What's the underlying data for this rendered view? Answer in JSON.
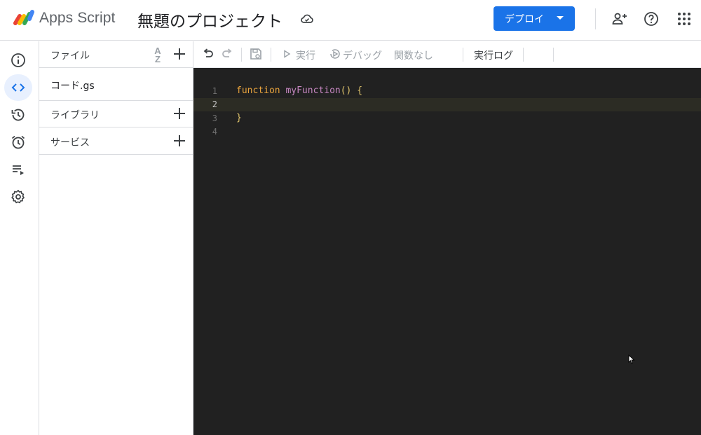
{
  "header": {
    "app_name": "Apps Script",
    "project_title": "無題のプロジェクト",
    "deploy_label": "デプロイ"
  },
  "panel": {
    "files_label": "ファイル",
    "sort_label_top": "A",
    "sort_label_bottom": "Z",
    "file_name": "コード.gs",
    "libraries_label": "ライブラリ",
    "services_label": "サービス"
  },
  "toolbar": {
    "run_label": "実行",
    "debug_label": "デバッグ",
    "function_select": "関数なし",
    "exec_log_label": "実行ログ"
  },
  "editor": {
    "line_numbers": [
      "1",
      "2",
      "3",
      "4"
    ],
    "line1_keyword": "function",
    "line1_name": "myFunction",
    "line1_parens": "()",
    "line1_brace": "{",
    "line3_brace": "}"
  },
  "colors": {
    "accent": "#1a73e8",
    "editor_bg": "#212121",
    "keyword": "#e8a33d",
    "function_name": "#c586c0"
  }
}
